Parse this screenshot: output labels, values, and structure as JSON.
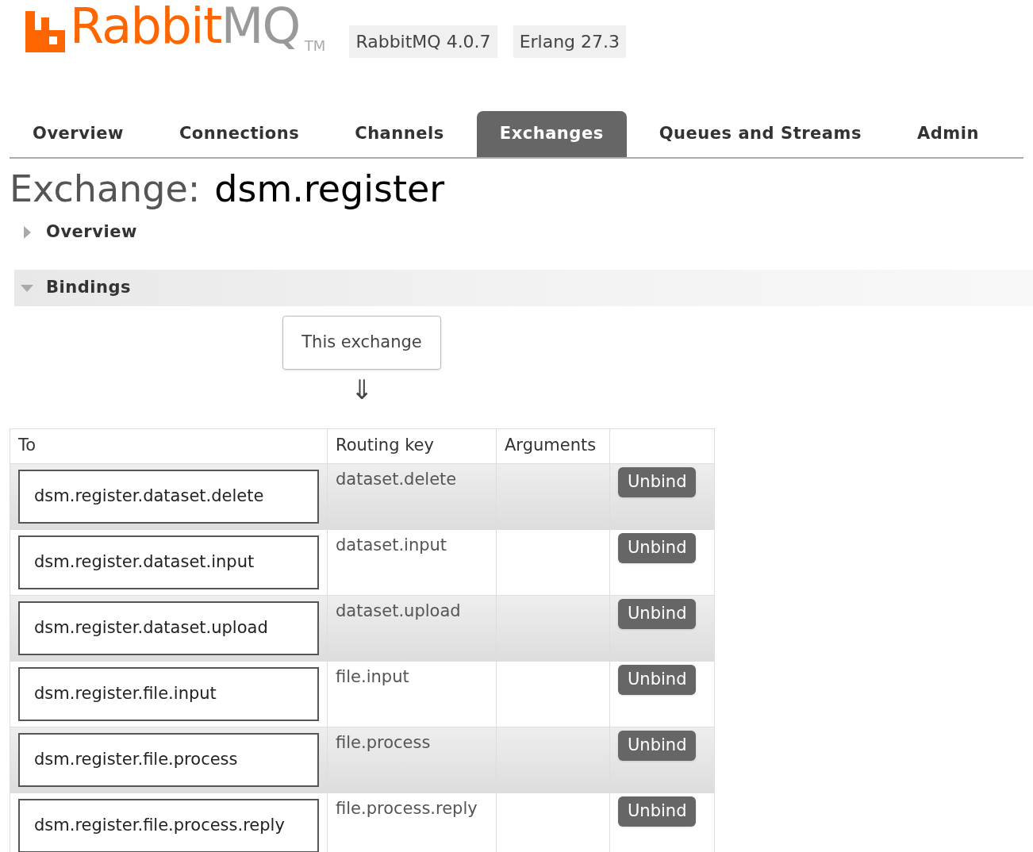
{
  "header": {
    "logo": {
      "primary": "Rabbit",
      "secondary": "MQ",
      "mark": "TM"
    },
    "versions": [
      "RabbitMQ 4.0.7",
      "Erlang 27.3"
    ]
  },
  "tabs": [
    {
      "label": "Overview",
      "selected": false
    },
    {
      "label": "Connections",
      "selected": false
    },
    {
      "label": "Channels",
      "selected": false
    },
    {
      "label": "Exchanges",
      "selected": true
    },
    {
      "label": "Queues and Streams",
      "selected": false
    },
    {
      "label": "Admin",
      "selected": false
    }
  ],
  "page_title": {
    "prefix": "Exchange:",
    "name": "dsm.register"
  },
  "sections": [
    {
      "title": "Overview",
      "expanded": false
    },
    {
      "title": "Bindings",
      "expanded": true
    }
  ],
  "bindings": {
    "source": "This exchange",
    "arrow": "⇓",
    "columns": [
      "To",
      "Routing key",
      "Arguments"
    ],
    "rows": [
      {
        "to": "dsm.register.dataset.delete",
        "routing_key": "dataset.delete",
        "action": "Unbind"
      },
      {
        "to": "dsm.register.dataset.input",
        "routing_key": "dataset.input",
        "action": "Unbind"
      },
      {
        "to": "dsm.register.dataset.upload",
        "routing_key": "dataset.upload",
        "action": "Unbind"
      },
      {
        "to": "dsm.register.file.input",
        "routing_key": "file.input",
        "action": "Unbind"
      },
      {
        "to": "dsm.register.file.process",
        "routing_key": "file.process",
        "action": "Unbind"
      },
      {
        "to": "dsm.register.file.process.reply",
        "routing_key": "file.process.reply",
        "action": "Unbind"
      }
    ]
  }
}
